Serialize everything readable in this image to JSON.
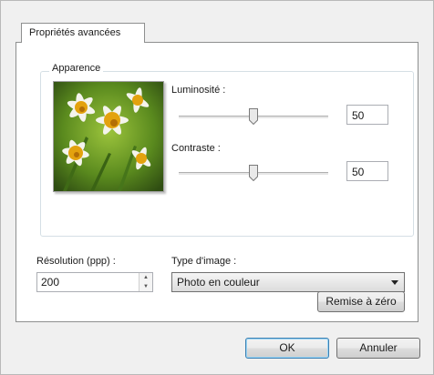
{
  "tab": {
    "label": "Propriétés avancées"
  },
  "appearance": {
    "title": "Apparence",
    "brightness": {
      "label": "Luminosité :",
      "value": "50",
      "level": 50
    },
    "contrast": {
      "label": "Contraste :",
      "value": "50",
      "level": 50
    }
  },
  "resolution": {
    "label": "Résolution (ppp) :",
    "value": "200"
  },
  "image_type": {
    "label": "Type d'image :",
    "selected": "Photo en couleur"
  },
  "buttons": {
    "reset": "Remise à zéro",
    "ok": "OK",
    "cancel": "Annuler"
  }
}
